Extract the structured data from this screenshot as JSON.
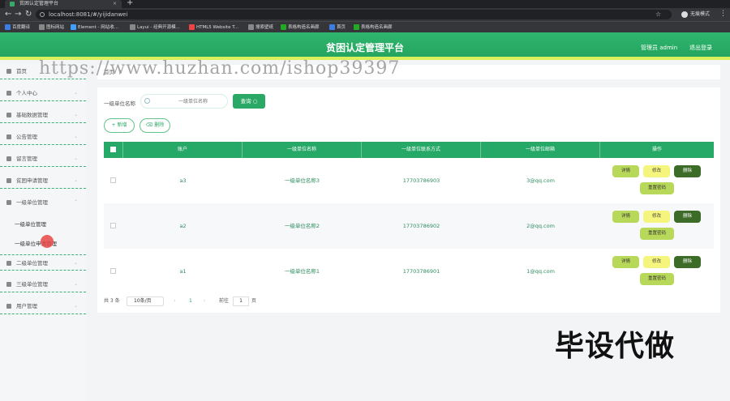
{
  "browser": {
    "tab_title": "贫困认定管理平台",
    "url": "localhost:8081/#/yijidanwei",
    "profile_label": "无痕模式",
    "bookmarks": [
      "百度翻译",
      "图标网站",
      "Element - 网站收...",
      "Layui - 经典开源模...",
      "HTML5 Website T...",
      "搜索壁纸",
      "表格构造名画廊",
      "首页",
      "表格构造名画廊"
    ]
  },
  "header": {
    "title": "贫困认定管理平台",
    "admin": "管理员 admin",
    "logout": "退出登录",
    "accent": "#29a866"
  },
  "watermark": "https://www.huzhan.com/ishop39397",
  "sidebar": {
    "items": [
      {
        "label": "首页",
        "icon": "home-icon"
      },
      {
        "label": "个人中心",
        "icon": "user-icon"
      },
      {
        "label": "基础数据管理",
        "icon": "list-icon"
      },
      {
        "label": "公告管理",
        "icon": "grid-icon"
      },
      {
        "label": "留言管理",
        "icon": "send-icon"
      },
      {
        "label": "贫困申请管理",
        "icon": "calendar-icon"
      },
      {
        "label": "一级单位管理",
        "icon": "user-icon"
      },
      {
        "label": "二级单位管理",
        "icon": "building-icon"
      },
      {
        "label": "三级单位管理",
        "icon": "user-icon"
      },
      {
        "label": "用户管理",
        "icon": "message-icon"
      }
    ],
    "subitems": [
      "一级单位管理",
      "一级单位申请管理"
    ]
  },
  "breadcrumb": {
    "home": "首页",
    "sep": "/"
  },
  "search": {
    "label": "一级单位名称",
    "placeholder": "一级单位名称",
    "query_button": "查询"
  },
  "toolbar": {
    "add": "新增",
    "delete": "删除"
  },
  "table": {
    "columns": [
      "账户",
      "一级单位名称",
      "一级单位联系方式",
      "一级单位邮箱",
      "操作"
    ],
    "rows": [
      {
        "account": "a3",
        "name": "一级单位名称3",
        "phone": "17703786903",
        "email": "3@qq.com"
      },
      {
        "account": "a2",
        "name": "一级单位名称2",
        "phone": "17703786902",
        "email": "2@qq.com"
      },
      {
        "account": "a1",
        "name": "一级单位名称1",
        "phone": "17703786901",
        "email": "1@qq.com"
      }
    ],
    "actions": {
      "detail": "详情",
      "edit": "修改",
      "delete": "删除",
      "fee": "重置密码"
    }
  },
  "pagination": {
    "total": "共 3 条",
    "page_size": "10条/页",
    "current_page": "1",
    "goto_label": "前往",
    "goto_value": "1",
    "page_suffix": "页"
  },
  "promo": "毕设代做"
}
